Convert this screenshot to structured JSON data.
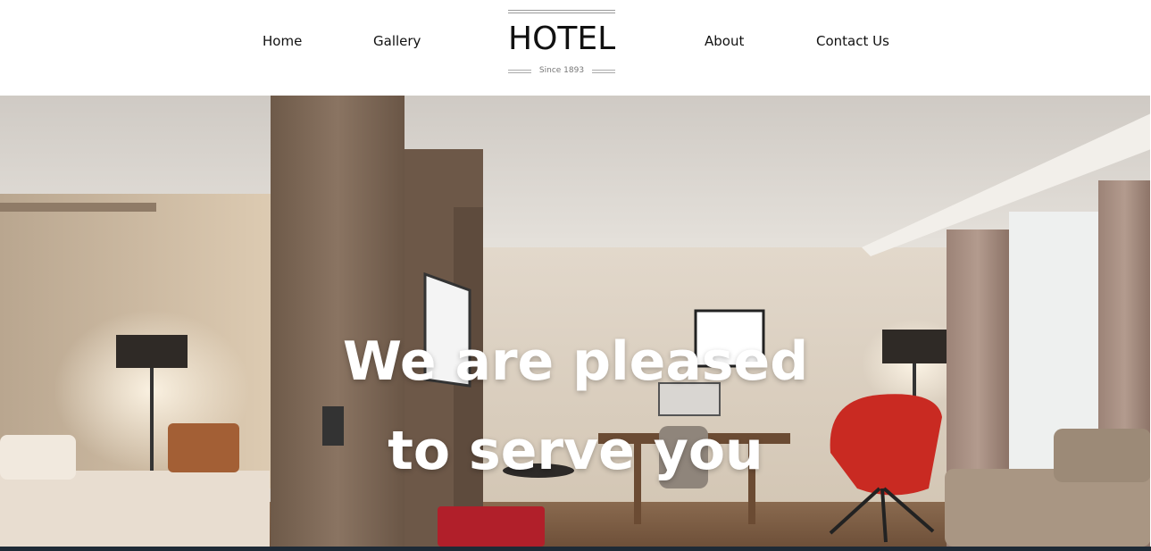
{
  "nav": {
    "home": "Home",
    "gallery": "Gallery",
    "about": "About",
    "contact": "Contact Us"
  },
  "logo": {
    "title": "HOTEL",
    "since": "Since 1893"
  },
  "hero": {
    "line1": "We are pleased",
    "line2": "to serve you",
    "image": "hotel-room-photo"
  },
  "colors": {
    "text": "#111111",
    "hero_text": "#ffffff",
    "footer_bar": "#1e2a36"
  }
}
